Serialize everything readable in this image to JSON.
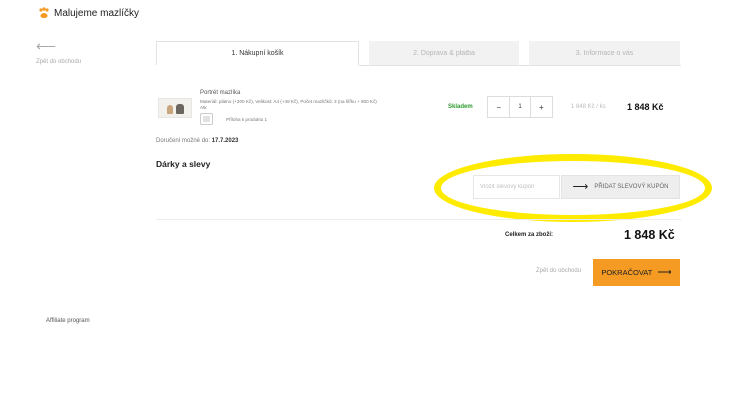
{
  "header": {
    "logo_text": "Malujeme mazlíčky",
    "back_to_shop": "Zpět do obchodu"
  },
  "tabs": [
    {
      "label": "1. Nákupní košík",
      "active": true
    },
    {
      "label": "2. Doprava & platba",
      "active": false
    },
    {
      "label": "3. Informace o vás",
      "active": false
    }
  ],
  "cart": {
    "item": {
      "name": "Portrét mazlíka",
      "meta_line1": "Materiál: plátno (+200 Kč), Velikost: A4 (+49 Kč), Počet mazlíčků: 3 (na šířku + 800 Kč)",
      "meta_line2": "Atk",
      "attachment": "Příloha k produktu 1",
      "stock": "Skladem",
      "qty_minus": "−",
      "qty": "1",
      "qty_plus": "+",
      "unit_price": "1 848 Kč / ks",
      "total": "1 848 Kč"
    },
    "delivery_prefix": "Doručení možné do: ",
    "delivery_date": "17.7.2023"
  },
  "discounts": {
    "title": "Dárky a slevy",
    "coupon_placeholder": "Vložit slevový kupón",
    "add_coupon_label": "PŘIDAT SLEVOVÝ KUPÓN",
    "arrow_icon": "arrow-right-icon"
  },
  "summary": {
    "total_label": "Celkem za zboží:",
    "total_value": "1 848 Kč"
  },
  "actions": {
    "back_link": "Zpět do obchodu",
    "continue_label": "POKRAČOVAT"
  },
  "footer": {
    "affiliate": "Affiliate program"
  },
  "colors": {
    "accent": "#f59a23",
    "stock": "#2e9a2e",
    "highlight": "#ffeb00"
  }
}
